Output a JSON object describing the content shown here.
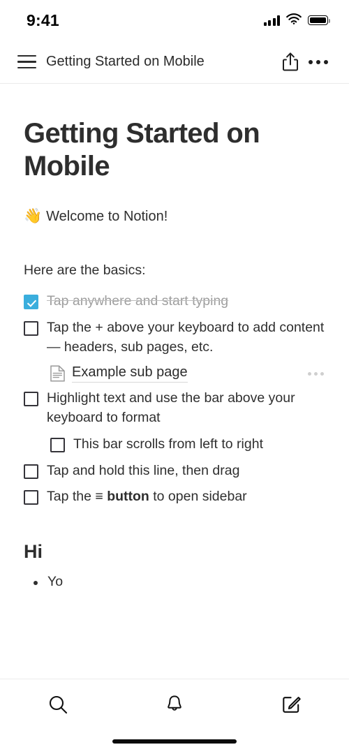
{
  "status_bar": {
    "time": "9:41",
    "cellular_icon": "cellular-bars-icon",
    "wifi_icon": "wifi-icon",
    "battery_icon": "battery-full-icon"
  },
  "nav_bar": {
    "menu_icon": "hamburger-menu-icon",
    "title": "Getting Started on Mobile",
    "share_icon": "share-icon",
    "more_icon": "more-options-icon"
  },
  "page": {
    "title": "Getting Started on Mobile",
    "welcome": {
      "emoji": "👋",
      "text": "Welcome to Notion!"
    },
    "basics_label": "Here are the basics:",
    "todos": [
      {
        "checked": true,
        "indent": 0,
        "text": "Tap anywhere and start typing"
      },
      {
        "checked": false,
        "indent": 0,
        "text": "Tap the + above your keyboard to add content — headers, sub pages, etc."
      },
      {
        "checked": false,
        "indent": 0,
        "text": "Highlight text and use the bar above your keyboard to format"
      },
      {
        "checked": false,
        "indent": 1,
        "text": "This bar scrolls from left to right"
      },
      {
        "checked": false,
        "indent": 0,
        "text": "Tap and hold this line, then drag"
      },
      {
        "checked": false,
        "indent": 0,
        "text_before": "Tap the ≡ ",
        "text_bold": "button",
        "text_after": " to open sidebar"
      }
    ],
    "subpage": {
      "icon": "document-page-icon",
      "title": "Example sub page",
      "more_icon": "more-options-icon"
    },
    "section_heading": "Hi",
    "bullets": [
      {
        "text": "Yo"
      }
    ]
  },
  "tab_bar": {
    "tabs": [
      {
        "name": "search",
        "icon": "search-icon"
      },
      {
        "name": "notifications",
        "icon": "bell-icon"
      },
      {
        "name": "new-note",
        "icon": "compose-icon"
      }
    ]
  },
  "colors": {
    "accent_checkbox": "#3aaedd",
    "text_primary": "#2f2f2f",
    "text_muted": "#9e9e9e",
    "divider": "#eaeaea",
    "background": "#ffffff"
  }
}
